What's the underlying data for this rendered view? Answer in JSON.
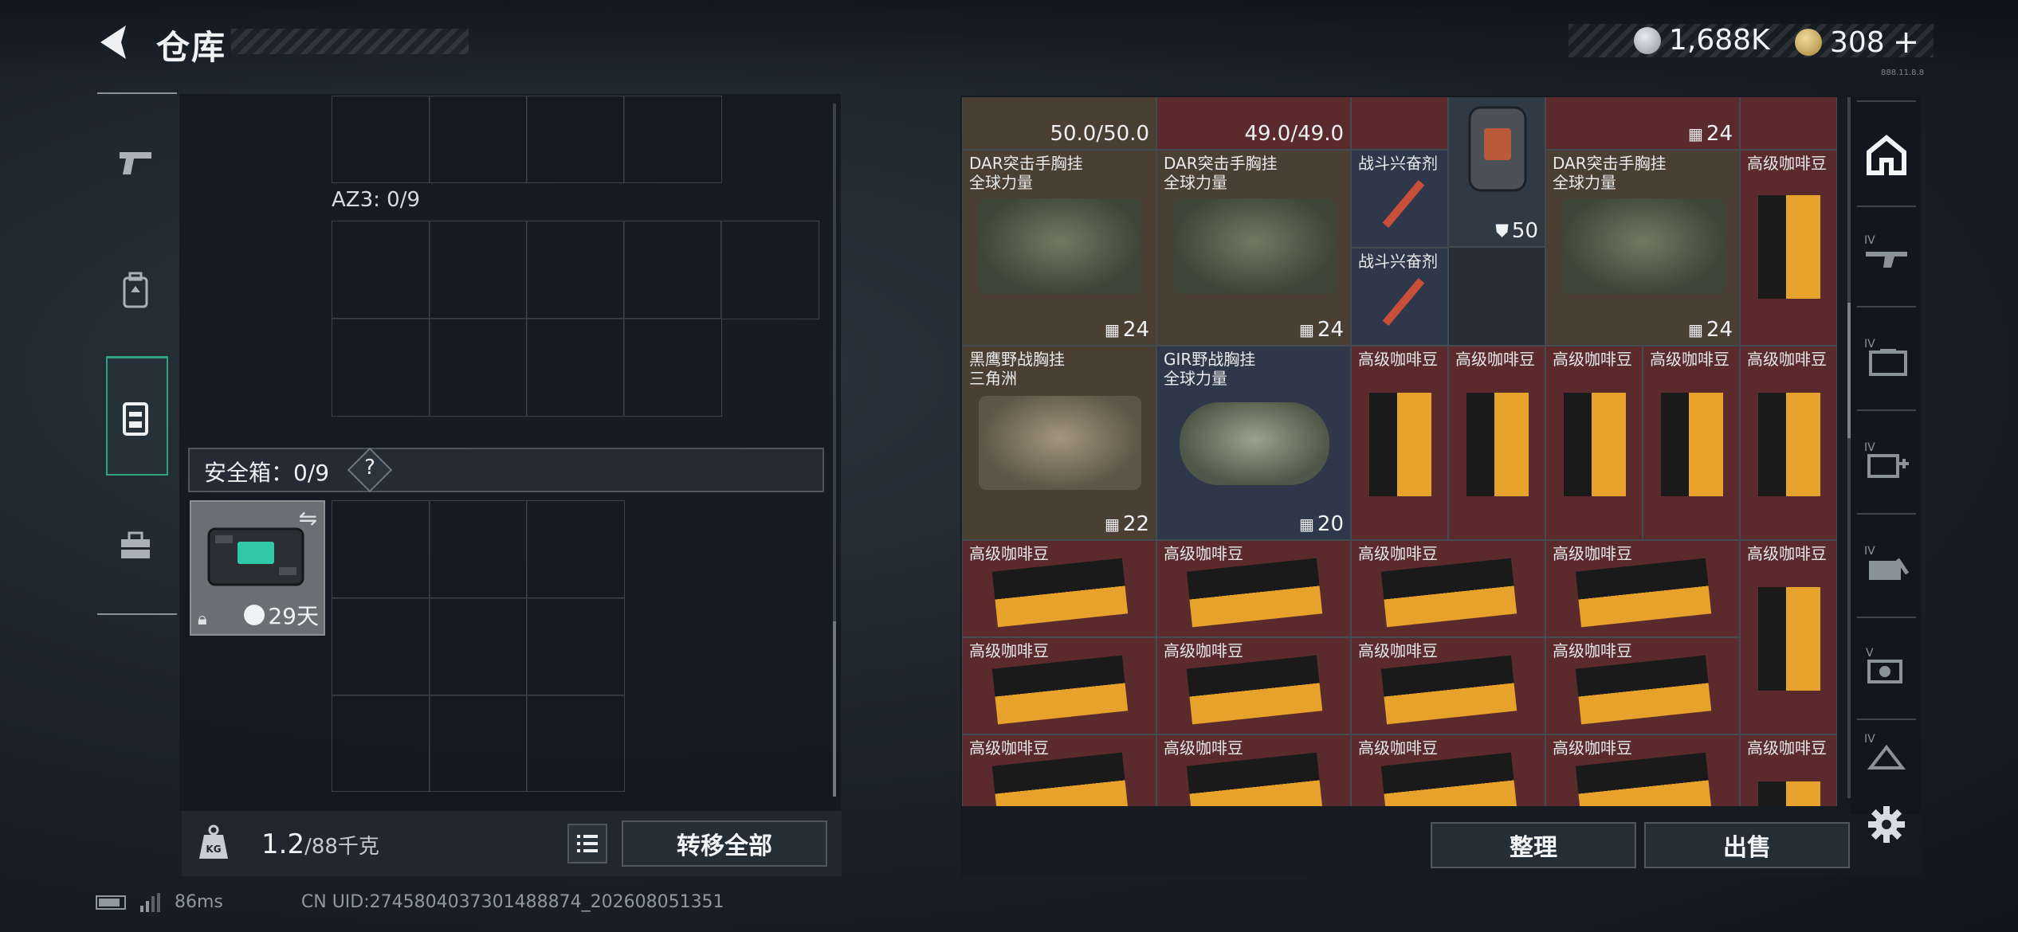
{
  "header": {
    "title": "仓库",
    "currency": [
      {
        "amount": "1,688K",
        "icon": "silver-coin-icon"
      },
      {
        "amount": "308",
        "icon": "gold-triangle-coin-icon",
        "add": "+"
      }
    ],
    "version": "888.11.8.8"
  },
  "left_rail": {
    "items": [
      {
        "icon": "pistol-icon"
      },
      {
        "icon": "backpack-icon"
      },
      {
        "icon": "vest-icon",
        "active": true
      },
      {
        "icon": "toolbox-icon"
      }
    ]
  },
  "loadout": {
    "az3_label": "AZ3: 0/9",
    "safe_label": "安全箱：0/9",
    "help": "?",
    "safe_item_duration": "29天"
  },
  "weight": {
    "current": "1.2",
    "max": "/88千克"
  },
  "buttons": {
    "transfer_all": "转移全部",
    "organize": "整理",
    "sell": "出售"
  },
  "stash": {
    "top_row": [
      {
        "durability": "50.0/50.0"
      },
      {
        "durability": "49.0/49.0"
      },
      {
        "count": "24"
      }
    ],
    "items": [
      {
        "name": "DAR突击手胸挂\n全球力量",
        "count": "24",
        "type": "rig"
      },
      {
        "name": "DAR突击手胸挂\n全球力量",
        "count": "24",
        "type": "rig"
      },
      {
        "name": "战斗兴奋剂",
        "type": "stim"
      },
      {
        "name": "战斗兴奋剂",
        "type": "stim"
      },
      {
        "armor": "50",
        "type": "armor"
      },
      {
        "name": "DAR突击手胸挂\n全球力量",
        "count": "24",
        "type": "rig"
      },
      {
        "name": "高级咖啡豆",
        "type": "coffee"
      },
      {
        "name": "黑鹰野战胸挂\n三角洲",
        "count": "22",
        "type": "rig"
      },
      {
        "name": "GIR野战胸挂\n全球力量",
        "count": "20",
        "type": "rig"
      },
      {
        "name": "高级咖啡豆",
        "type": "coffee"
      }
    ],
    "coffee_label": "高级咖啡豆"
  },
  "right_rail": {
    "tabs": [
      "home-icon",
      "rifle-iv-icon",
      "case-iv-icon",
      "medkit-iv-icon",
      "tools-iv-icon",
      "camera-v-icon",
      "misc-iv-icon"
    ],
    "settings_icon": "gear-icon"
  },
  "status": {
    "ping": "86ms",
    "uid": "CN UID:2745804037301488874_202608051351"
  },
  "colors": {
    "accent": "#2fa37e",
    "rare_red": "#5a2a2c",
    "item_brown": "#4a3f33",
    "item_blue": "#2f384a"
  }
}
